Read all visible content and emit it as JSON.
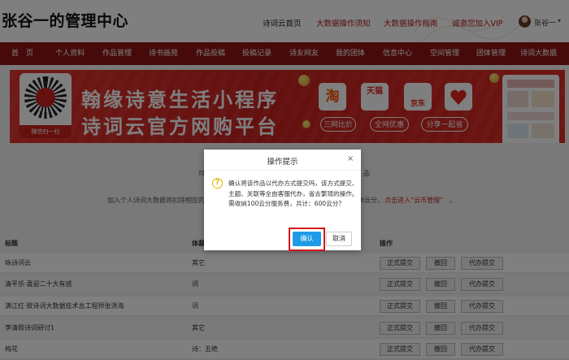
{
  "header": {
    "site_title": "张谷一的管理中心",
    "links": [
      {
        "label": "诗词云首页",
        "color": "#222222"
      },
      {
        "label": "大数据操作须知",
        "color": "#b51a1a"
      },
      {
        "label": "大数据操作指南",
        "color": "#b51a1a"
      },
      {
        "label": "诚邀您加入VIP",
        "color": "#b51a1a"
      }
    ],
    "user_name": "张谷一"
  },
  "nav": {
    "items": [
      "首　页",
      "个人资料",
      "作品管理",
      "诗书画苑",
      "作品投稿",
      "投稿记录",
      "诗友网友",
      "我的团体",
      "信息中心",
      "空间管理",
      "团体管理",
      "诗词大数据"
    ]
  },
  "banner": {
    "qr_caption": "微信扫一扫",
    "line1": "翰缘诗意生活小程序",
    "line2": "诗词云官方网购平台",
    "shops": [
      {
        "icon": "淘",
        "button": "三网比价"
      },
      {
        "icon": "天猫",
        "button": "全网优惠"
      },
      {
        "icon": "京东",
        "button": "分享一起省"
      }
    ]
  },
  "page": {
    "info_a": "可",
    "info_b": "品",
    "info_c": "加入个人诗词大数据将扣除相应的",
    "info_d": "8云分，",
    "info_link": "点击进入“云币管理”",
    "info_end": "。"
  },
  "table": {
    "headers": {
      "title": "标题",
      "genre": "体裁",
      "action": "操作"
    },
    "rows": [
      {
        "title": "咏诗词云",
        "genre": "其它"
      },
      {
        "title": "清平乐·喜迎二十大有感",
        "genre": "词"
      },
      {
        "title": "满江红·致诗词大数据技术总工程师张洪海",
        "genre": "词"
      },
      {
        "title": "李清照诗词研讨1",
        "genre": "其它"
      },
      {
        "title": "梅花",
        "genre": "诗：五绝"
      }
    ],
    "buttons": {
      "submit": "正式提交",
      "withdraw": "撤回",
      "proxy": "代办提交"
    }
  },
  "dialog": {
    "title": "操作提示",
    "close": "×",
    "message": "确认将该作品以代办方式提交吗，该方式提交、主题、关联等全由客服代办，省去繁琐的操作。需收纳100云分服务费，共计：600云分？",
    "ok": "确认",
    "cancel": "取消"
  }
}
